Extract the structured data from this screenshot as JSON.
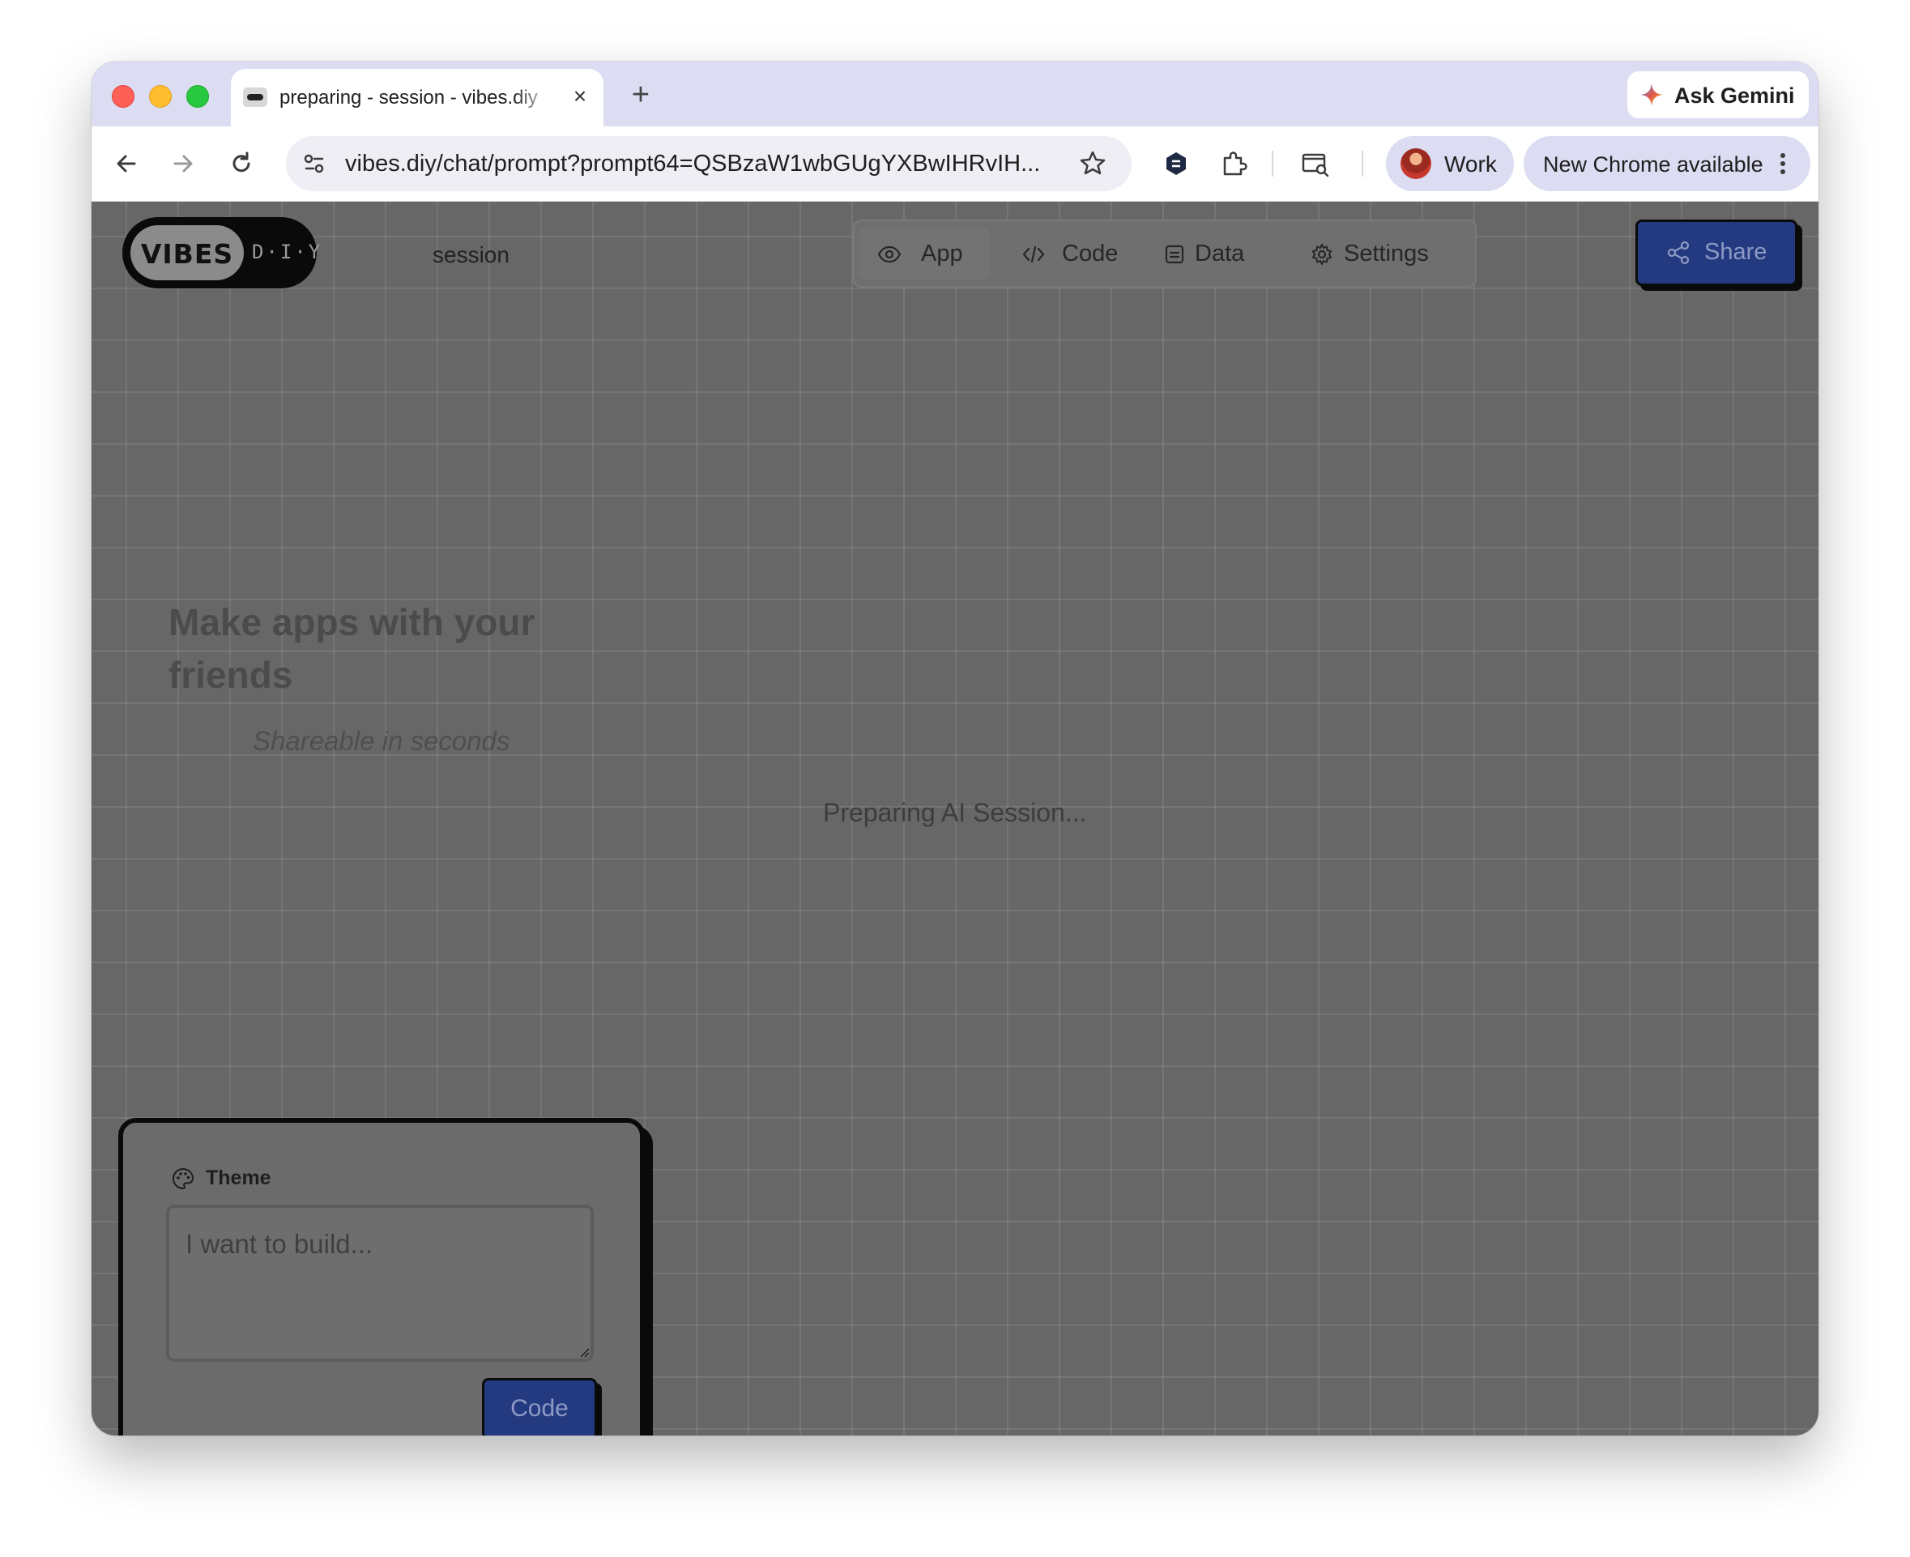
{
  "browser": {
    "tab": {
      "title": "preparing - session - vibes.diy",
      "close_icon": "×"
    },
    "new_tab_icon": "+",
    "ask_gemini_label": "Ask Gemini",
    "address_bar": {
      "url": "vibes.diy/chat/prompt?prompt64=QSBzaW1wbGUgYXBwIHRvIH..."
    },
    "profile": {
      "label": "Work"
    },
    "update_label": "New Chrome available"
  },
  "app": {
    "logo": {
      "main": "VIBES",
      "suffix": "D·I·Y"
    },
    "session_title": "session",
    "tabs": [
      {
        "label": "App",
        "icon": "eye-icon",
        "active": true
      },
      {
        "label": "Code",
        "icon": "code-icon",
        "active": false
      },
      {
        "label": "Data",
        "icon": "database-icon",
        "active": false
      },
      {
        "label": "Settings",
        "icon": "gear-icon",
        "active": false
      }
    ],
    "share_label": "Share",
    "hero_heading": "Make apps with your friends",
    "hero_tagline": "Shareable in seconds",
    "status_text": "Preparing AI Session...",
    "prompt_panel": {
      "theme_label": "Theme",
      "placeholder": "I want to build...",
      "submit_label": "Code"
    }
  },
  "colors": {
    "accent_blue": "#243a80",
    "overlay_gray": "#676767",
    "chrome_frame": "#dcdcf2"
  }
}
